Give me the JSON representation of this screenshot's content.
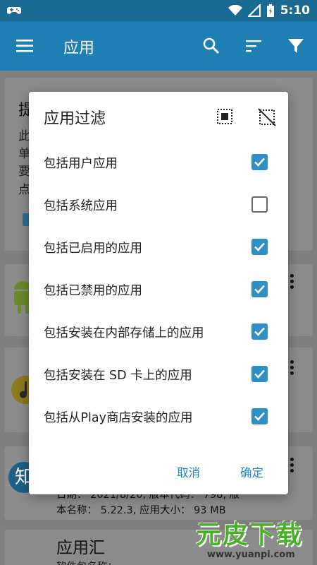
{
  "status_bar": {
    "time": "5:10"
  },
  "app_bar": {
    "title": "应用"
  },
  "background": {
    "card1": {
      "heading": "提",
      "lines": [
        "此",
        "单",
        "要",
        "点"
      ]
    },
    "card4": {
      "line1": "日期：  2021/8/20, 版本代码：  798, 版",
      "line2": "本名称：  5.22.3, 应用大小：  93 MB"
    },
    "card5": {
      "name": "应用汇",
      "sub": "软件包名称："
    }
  },
  "dialog": {
    "title": "应用过滤",
    "options": [
      {
        "label": "包括用户应用",
        "checked": true
      },
      {
        "label": "包括系统应用",
        "checked": false
      },
      {
        "label": "包括已启用的应用",
        "checked": true
      },
      {
        "label": "包括已禁用的应用",
        "checked": true
      },
      {
        "label": "包括安装在内部存储上的应用",
        "checked": true
      },
      {
        "label": "包括安装在 SD 卡上的应用",
        "checked": true
      },
      {
        "label": "包括从Play商店安装的应用",
        "checked": true
      }
    ],
    "cancel": "取消",
    "ok": "确定"
  },
  "watermark": {
    "brand": "元皮下载",
    "url": "www.yuanpi.com"
  },
  "colors": {
    "appbar": "#1d7fb4",
    "statusbar": "#1b6a93",
    "accent": "#2e8fc4",
    "button_text": "#1d88c4"
  }
}
